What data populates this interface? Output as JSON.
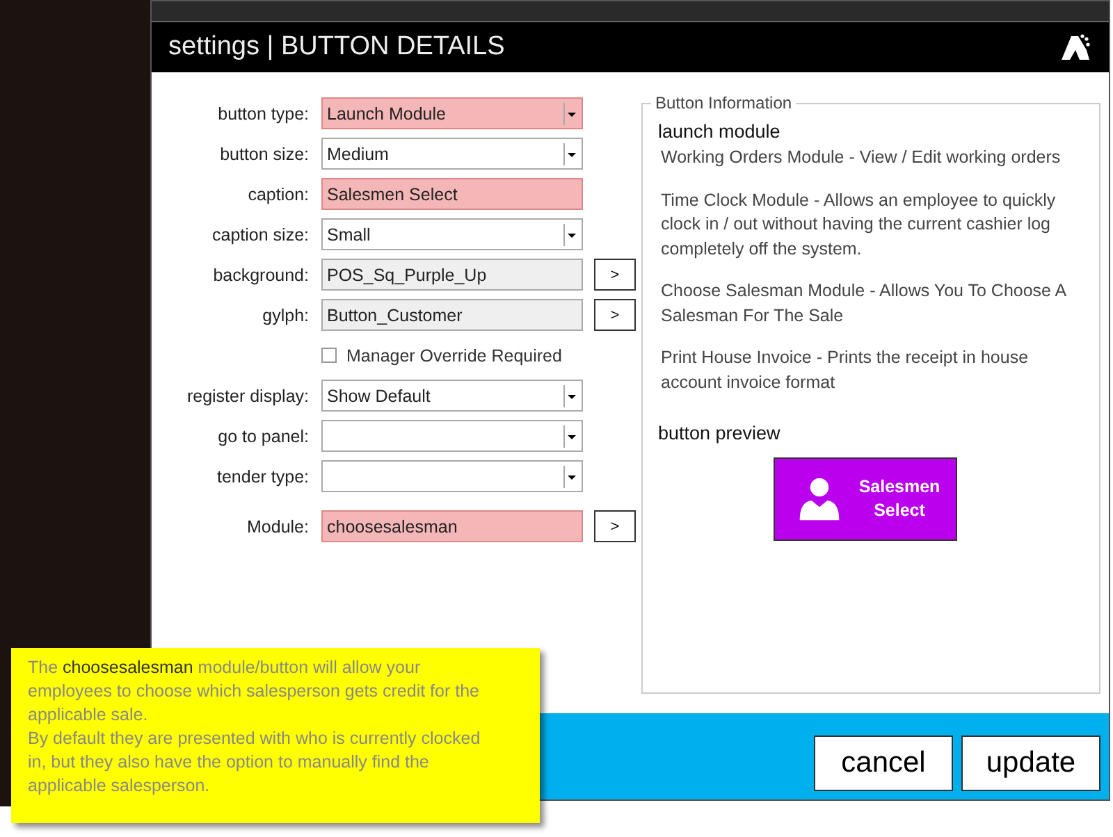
{
  "window": {
    "title": "settings | BUTTON DETAILS"
  },
  "fields": [
    {
      "label": "button type:",
      "kind": "select",
      "value": "Launch Module",
      "highlighted": true
    },
    {
      "label": "button size:",
      "kind": "select",
      "value": "Medium",
      "highlighted": false
    },
    {
      "label": "caption:",
      "kind": "text",
      "value": "Salesmen Select",
      "highlighted": true
    },
    {
      "label": "caption size:",
      "kind": "select",
      "value": "Small",
      "highlighted": false
    },
    {
      "label": "background:",
      "kind": "browse",
      "value": "POS_Sq_Purple_Up",
      "highlighted": false,
      "button": ">"
    },
    {
      "label": "gylph:",
      "kind": "browse",
      "value": "Button_Customer",
      "highlighted": false,
      "button": ">"
    },
    {
      "label": "Manager Override Required",
      "kind": "checkbox",
      "checked": false
    },
    {
      "label": "register display:",
      "kind": "select",
      "value": "Show Default",
      "highlighted": false
    },
    {
      "label": "go to panel:",
      "kind": "select",
      "highlighted": false
    },
    {
      "label": "tender type:",
      "kind": "select",
      "highlighted": false
    },
    {
      "label": "Module:",
      "kind": "browse",
      "value": "choosesalesman",
      "highlighted": true,
      "button": ">"
    }
  ],
  "info": {
    "legend": "Button Information",
    "heading": "launch module",
    "paragraphs": [
      "Working Orders Module - View / Edit working orders",
      "Time Clock Module - Allows an employee to quickly clock in / out without having the current cashier log completely off the system.",
      "Choose Salesman Module - Allows You To Choose A Salesman For The Sale",
      "Print House Invoice - Prints the receipt in house account invoice format"
    ],
    "preview_heading": "button preview",
    "preview": {
      "caption_lines": [
        "Salesmen",
        "Select"
      ],
      "color": "#bb00ee"
    }
  },
  "buttons": [
    "cancel",
    "update"
  ],
  "tooltip": {
    "lines": [
      "The **choosesalesman** module/button will allow your employees to choose which salesperson gets credit for the applicable sale.",
      "By default they are presented with who is currently clocked in, but they also have the option to manually find the applicable salesperson."
    ]
  }
}
